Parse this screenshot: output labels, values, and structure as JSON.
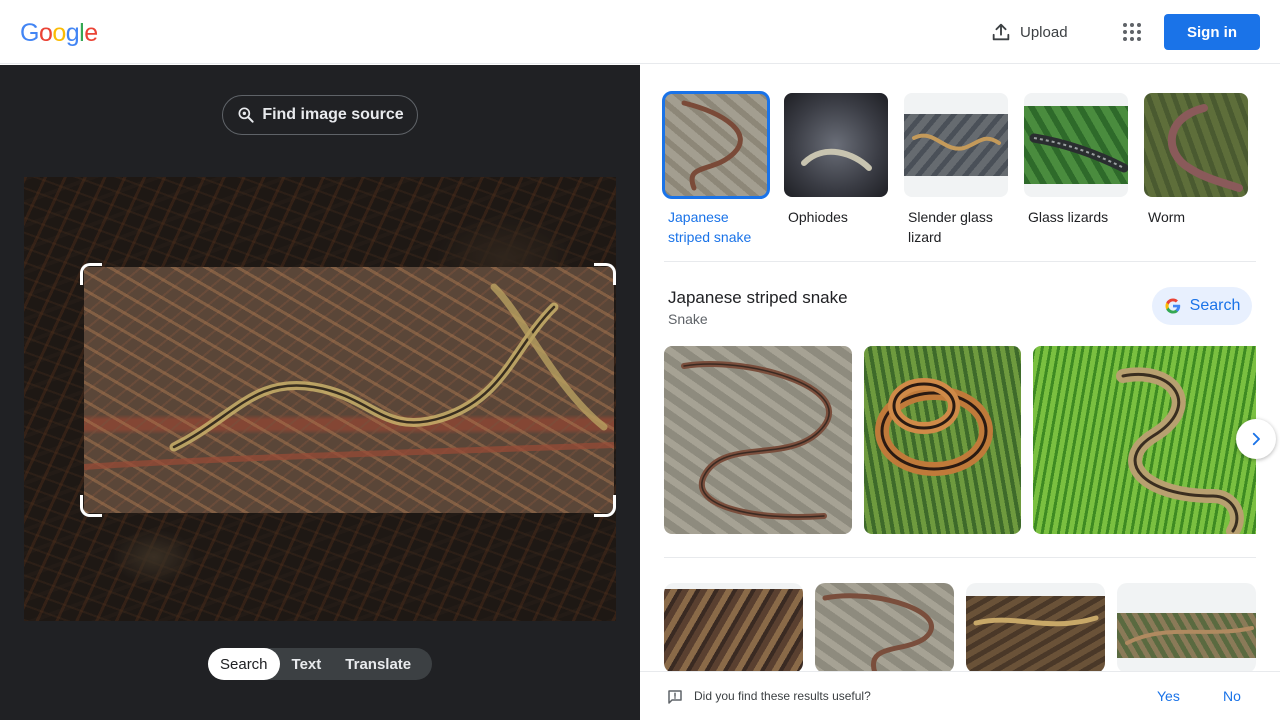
{
  "header": {
    "logo_letters": [
      "G",
      "o",
      "o",
      "g",
      "l",
      "e"
    ],
    "logo_colors": [
      "#4285f4",
      "#ea4335",
      "#fbbc05",
      "#4285f4",
      "#34a853",
      "#ea4335"
    ],
    "upload_label": "Upload",
    "signin_label": "Sign in"
  },
  "left_pane": {
    "find_source_label": "Find image source",
    "mode_tabs": [
      {
        "label": "Search",
        "active": true
      },
      {
        "label": "Text",
        "active": false
      },
      {
        "label": "Translate",
        "active": false
      }
    ]
  },
  "right_pane": {
    "chips": [
      {
        "label": "Japanese striped snake",
        "active": true
      },
      {
        "label": "Ophiodes",
        "active": false
      },
      {
        "label": "Slender glass lizard",
        "active": false
      },
      {
        "label": "Glass lizards",
        "active": false
      },
      {
        "label": "Worm",
        "active": false
      }
    ],
    "entity": {
      "title": "Japanese striped snake",
      "subtitle": "Snake",
      "search_label": "Search"
    },
    "feedback": {
      "question": "Did you find these results useful?",
      "yes": "Yes",
      "no": "No"
    }
  },
  "colors": {
    "accent": "#1a73e8",
    "dark_bg": "#202124"
  },
  "icons": [
    "upload-icon",
    "apps-grid-icon",
    "lens-search-icon",
    "google-g-icon",
    "chevron-right-icon",
    "feedback-icon"
  ]
}
